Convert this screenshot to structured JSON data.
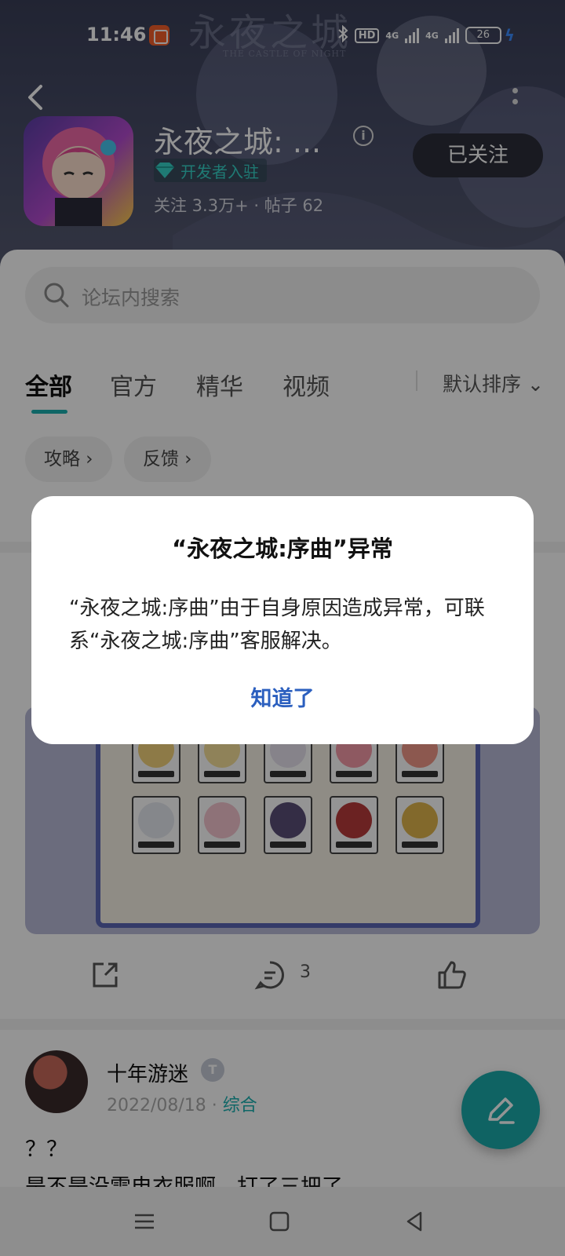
{
  "status_bar": {
    "time": "11:46",
    "hd_label": "HD",
    "net1": "4G",
    "net2": "4G",
    "battery": "26"
  },
  "banner": {
    "title": "永夜之城",
    "subtitle": "THE CASTLE OF NIGHT"
  },
  "header": {
    "app_name": "永夜之城:  ...",
    "developer_badge": "开发者入驻",
    "stats": "关注 3.3万+ · 帖子 62",
    "follow_button": "已关注",
    "info_glyph": "i"
  },
  "search": {
    "placeholder": "论坛内搜索"
  },
  "tabs": {
    "items": [
      "全部",
      "官方",
      "精华",
      "视频"
    ],
    "active_index": 0,
    "sort_label": "默认排序 ⌄"
  },
  "chips": [
    "攻略 ›",
    "反馈 ›"
  ],
  "post1": {
    "comment_count": "3"
  },
  "post2": {
    "author": "十年游迷",
    "level": "T",
    "date": "2022/08/18 · ",
    "category": "综合",
    "text": "？？",
    "text2": "是不是没雷电衣服啊，打了三把了"
  },
  "dialog": {
    "title": "“永夜之城:序曲”异常",
    "message": "“永夜之城:序曲”由于自身原因造成异常，可联系“永夜之城:序曲”客服解决。",
    "button": "知道了"
  },
  "colors": {
    "accent": "#1bb0b0",
    "dialog_button": "#2b5fbf",
    "header_bg": "#3a3f58"
  },
  "icons": [
    "back-icon",
    "more-icon",
    "info-icon",
    "search-icon",
    "share-icon",
    "comment-icon",
    "like-icon",
    "pen-icon",
    "menu-icon",
    "home-icon",
    "back-nav-icon"
  ]
}
